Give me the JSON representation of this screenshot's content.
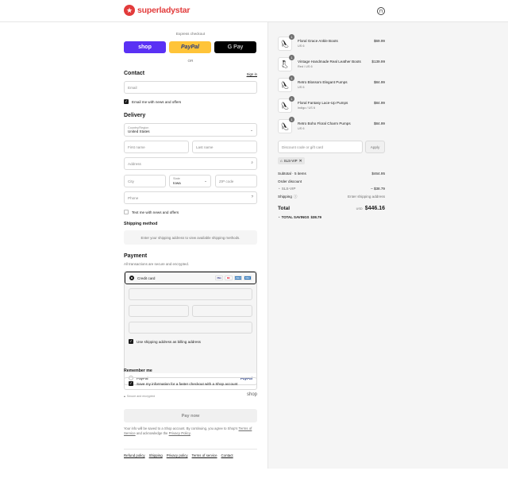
{
  "brand": {
    "name": "superladystar",
    "accent": "#e23b3b"
  },
  "express": {
    "label": "Express checkout",
    "shop": "shop",
    "paypal": "PayPal",
    "gpay": "G Pay",
    "or": "OR"
  },
  "contact": {
    "heading": "Contact",
    "sign_in": "Sign in",
    "email_placeholder": "Email",
    "news_label": "Email me with news and offers"
  },
  "delivery": {
    "heading": "Delivery",
    "country_label": "Country/Region",
    "country_value": "United States",
    "first_name_placeholder": "First name",
    "last_name_placeholder": "Last name",
    "address_placeholder": "Address",
    "city_placeholder": "City",
    "state_label": "State",
    "state_value": "Iowa",
    "zip_placeholder": "ZIP code",
    "phone_placeholder": "Phone",
    "text_label": "Text me with news and offers"
  },
  "shipping": {
    "heading": "Shipping method",
    "note": "Enter your shipping address to view available shipping methods."
  },
  "payment": {
    "heading": "Payment",
    "subtext": "All transactions are secure and encrypted.",
    "credit_card": "Credit card",
    "cards": [
      {
        "name": "VISA",
        "color": "#ffffff",
        "text": "#1a1f71"
      },
      {
        "name": "MC",
        "color": "#ffffff",
        "text": "#eb001b"
      },
      {
        "name": "AMEX",
        "color": "#2e77bc",
        "text": "#ffffff"
      },
      {
        "name": "DISC",
        "color": "#2e77bc",
        "text": "#ffffff"
      }
    ],
    "billing_label": "Use shipping address as billing address",
    "paypal": "PayPal",
    "paypal_logo": "PayPal"
  },
  "remember": {
    "heading": "Remember me",
    "save_label": "Save my information for a faster checkout with a Shop account",
    "secure": "Secure and encrypted",
    "shop_logo": "shop"
  },
  "pay_now": "Pay now",
  "legal": {
    "text1": "Your info will be saved to a Shop account. By continuing, you agree to Shop's",
    "tos": "Terms of Service",
    "text2": "and acknowledge the",
    "privacy": "Privacy Policy",
    "end": "."
  },
  "footer": [
    "Refund policy",
    "Shipping",
    "Privacy policy",
    "Terms of service",
    "Contact"
  ],
  "items": [
    {
      "name": "Floral Grace Ankle Boots",
      "variant": "US 6",
      "price": "$69.99",
      "qty": "1",
      "icon": "shoe-icon"
    },
    {
      "name": "Vintage Handmade Real Leather Boots",
      "variant": "Red / US 6",
      "price": "$139.99",
      "qty": "1",
      "icon": "boot-icon"
    },
    {
      "name": "Retro Blossom Elegant Pumps",
      "variant": "US 6",
      "price": "$84.99",
      "qty": "1",
      "icon": "shoe-icon"
    },
    {
      "name": "Floral Fantasy Lace-Up Pumps",
      "variant": "Indigo / US 6",
      "price": "$84.99",
      "qty": "1",
      "icon": "shoe-icon"
    },
    {
      "name": "Retro Boho Floral Charm Pumps",
      "variant": "US 6",
      "price": "$84.99",
      "qty": "1",
      "icon": "shoe-icon"
    }
  ],
  "discount": {
    "placeholder": "Discount code or gift card",
    "apply": "Apply",
    "tag": "SLS-VIP"
  },
  "summary": {
    "subtotal_label": "Subtotal · 5 items",
    "subtotal_value": "$464.95",
    "order_discount_label": "Order discount",
    "code_label": "SLS-VIP",
    "code_value": "– $38.79",
    "shipping_label": "Shipping",
    "shipping_value": "Enter shipping address",
    "total_label": "Total",
    "currency": "USD",
    "total_value": "$446.16",
    "savings_label": "TOTAL SAVINGS",
    "savings_value": "$38.79"
  }
}
